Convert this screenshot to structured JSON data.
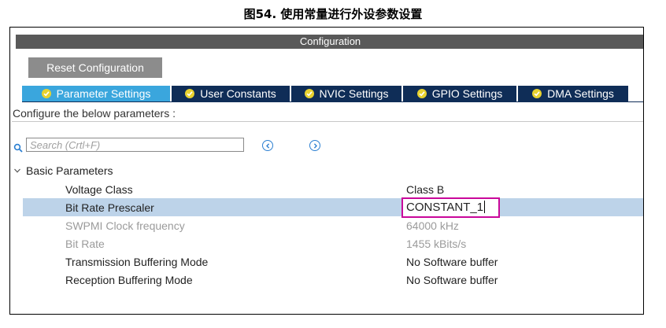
{
  "caption": "图54. 使用常量进行外设参数设置",
  "window": {
    "title": "Configuration"
  },
  "toolbar": {
    "reset_label": "Reset Configuration"
  },
  "tabs": [
    {
      "label": "Parameter Settings",
      "active": true
    },
    {
      "label": "User Constants",
      "active": false
    },
    {
      "label": "NVIC Settings",
      "active": false
    },
    {
      "label": "GPIO Settings",
      "active": false
    },
    {
      "label": "DMA Settings",
      "active": false
    }
  ],
  "configure_text": "Configure the below parameters :",
  "search": {
    "placeholder": "Search (Crtl+F)"
  },
  "group": {
    "label": "Basic Parameters"
  },
  "params": [
    {
      "name": "Voltage Class",
      "value": "Class B",
      "state": "enabled"
    },
    {
      "name": "Bit Rate Prescaler",
      "value": "CONSTANT_1",
      "state": "editing"
    },
    {
      "name": "SWPMI Clock frequency",
      "value": "64000 kHz",
      "state": "disabled"
    },
    {
      "name": "Bit Rate",
      "value": "1455 kBits/s",
      "state": "disabled"
    },
    {
      "name": "Transmission Buffering Mode",
      "value": "No Software buffer",
      "state": "enabled"
    },
    {
      "name": "Reception Buffering Mode",
      "value": "No Software buffer",
      "state": "enabled"
    }
  ],
  "colors": {
    "tab_active": "#3aa6dd",
    "tab_inactive": "#0f2d57",
    "check_badge": "#e8d22f",
    "edit_highlight": "#c9089a",
    "row_selected": "#bdd3e9",
    "title_bar": "#595959"
  },
  "icons": {
    "tab_check": "check-circle-icon",
    "search": "search-icon",
    "prev": "chevron-left-circle-icon",
    "next": "chevron-right-circle-icon",
    "group": "chevron-down-icon"
  }
}
